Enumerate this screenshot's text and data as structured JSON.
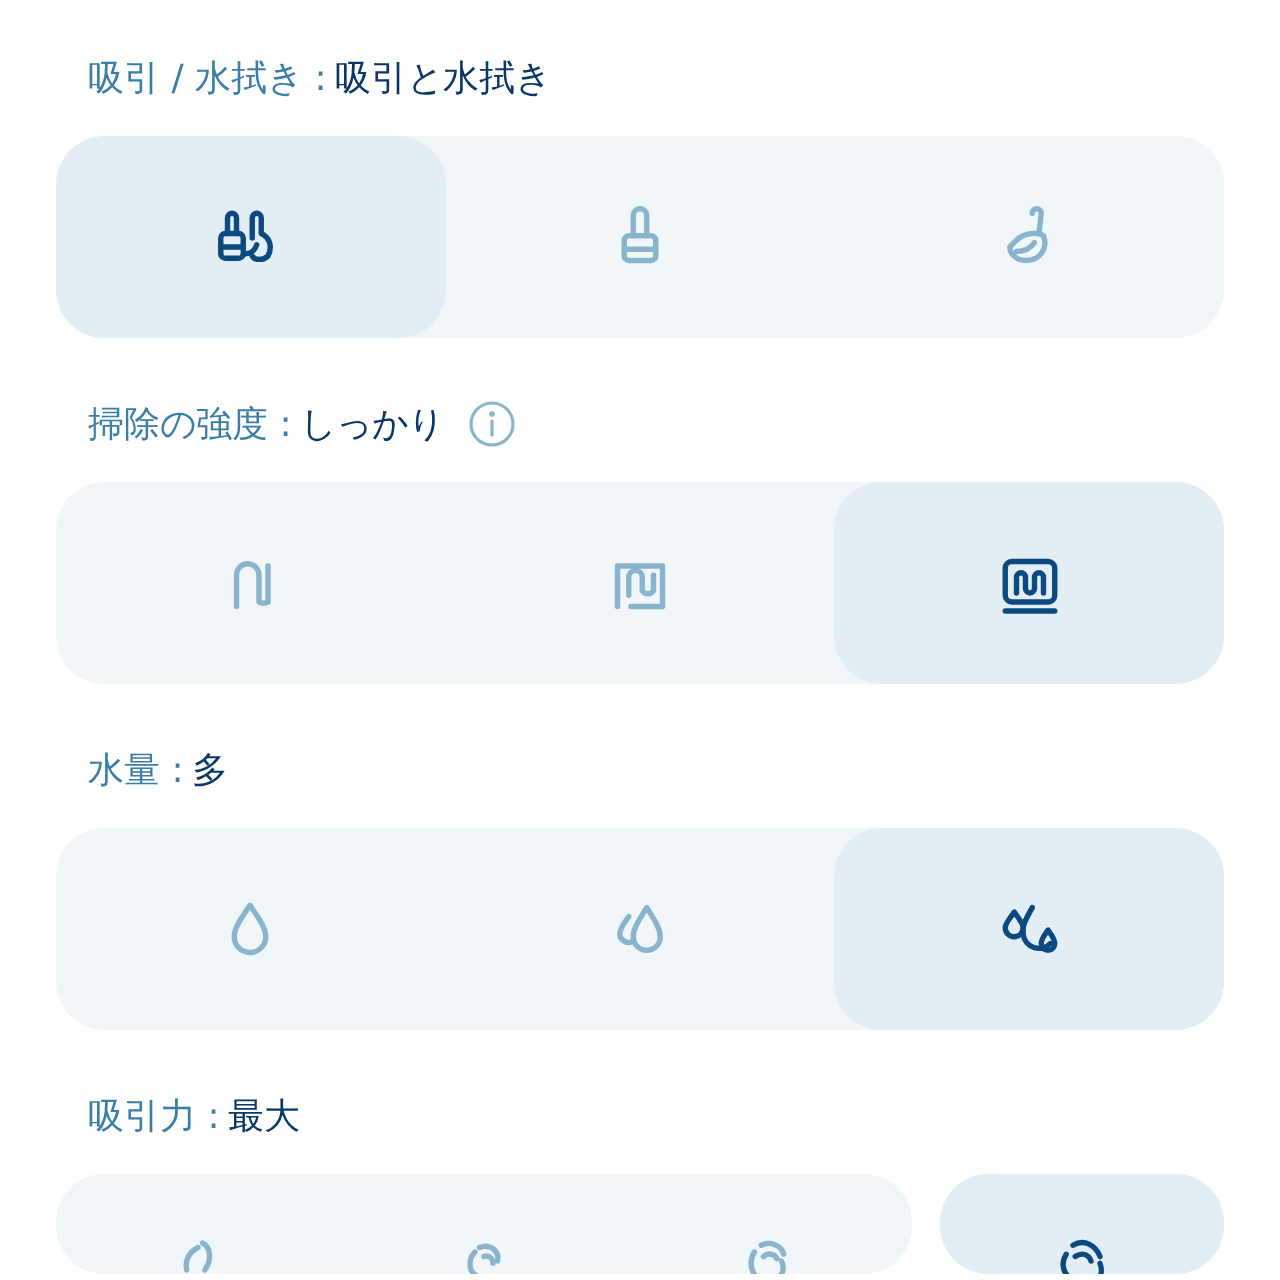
{
  "sections": [
    {
      "label": "吸引 / 水拭き :",
      "value": "吸引と水拭き",
      "info": false,
      "groups": [
        [
          {
            "selected": true
          },
          {
            "selected": false
          },
          {
            "selected": false
          }
        ]
      ]
    },
    {
      "label": "掃除の強度 :",
      "value": "しっかり",
      "info": true,
      "groups": [
        [
          {
            "selected": false
          },
          {
            "selected": false
          },
          {
            "selected": true
          }
        ]
      ]
    },
    {
      "label": "水量 :",
      "value": "多",
      "info": false,
      "groups": [
        [
          {
            "selected": false
          },
          {
            "selected": false
          },
          {
            "selected": true
          }
        ]
      ]
    },
    {
      "label": "吸引力 :",
      "value": "最大",
      "info": false,
      "groups": [
        [
          {
            "selected": false
          },
          {
            "selected": false
          },
          {
            "selected": false
          }
        ],
        [
          {
            "selected": true
          }
        ]
      ]
    }
  ]
}
